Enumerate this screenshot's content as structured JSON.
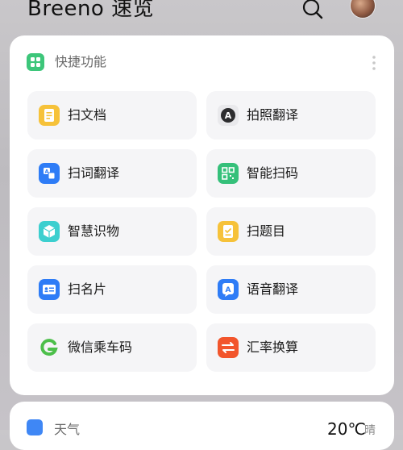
{
  "app": {
    "title": "Breeno 速览"
  },
  "quick_card": {
    "title": "快捷功能",
    "tiles": [
      {
        "label": "扫文档",
        "icon": "document-scan-icon",
        "color": "#f6c23a"
      },
      {
        "label": "拍照翻译",
        "icon": "photo-translate-icon",
        "color": "#3a3a3c"
      },
      {
        "label": "扫词翻译",
        "icon": "word-translate-icon",
        "color": "#2e7cf6"
      },
      {
        "label": "智能扫码",
        "icon": "qr-scan-icon",
        "color": "#35c07a"
      },
      {
        "label": "智慧识物",
        "icon": "object-recognition-icon",
        "color": "#3ccfcf"
      },
      {
        "label": "扫题目",
        "icon": "question-scan-icon",
        "color": "#f6c23a"
      },
      {
        "label": "扫名片",
        "icon": "business-card-icon",
        "color": "#2e7cf6"
      },
      {
        "label": "语音翻译",
        "icon": "voice-translate-icon",
        "color": "#2e7cf6"
      },
      {
        "label": "微信乘车码",
        "icon": "wechat-transit-icon",
        "color": "#4cbf4a"
      },
      {
        "label": "汇率换算",
        "icon": "currency-exchange-icon",
        "color": "#f2552c"
      }
    ]
  },
  "weather_card": {
    "title": "天气",
    "temperature": "20℃",
    "condition": "晴"
  }
}
